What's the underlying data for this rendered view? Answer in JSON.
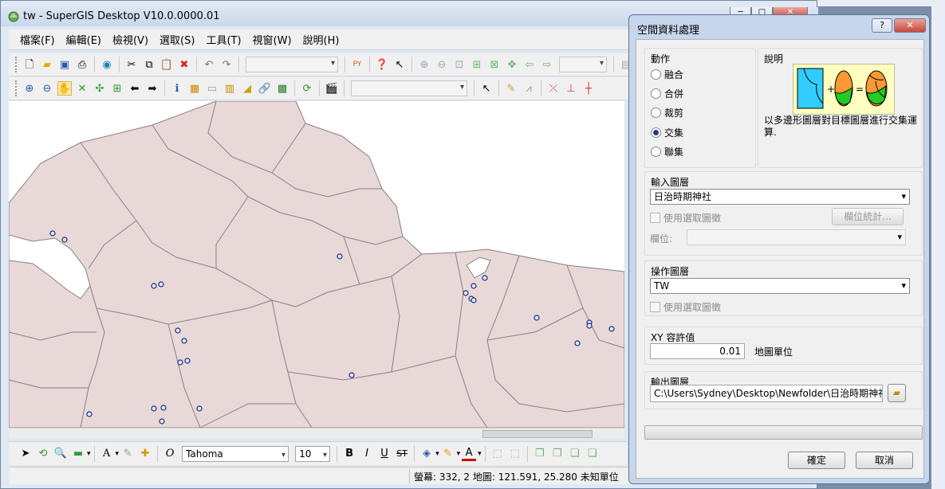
{
  "main_window": {
    "title": "tw - SuperGIS Desktop V10.0.0000.01",
    "menu": [
      "檔案(F)",
      "編輯(E)",
      "檢視(V)",
      "選取(S)",
      "工具(T)",
      "視窗(W)",
      "說明(H)"
    ]
  },
  "draw_toolbar": {
    "font_name": "Tahoma",
    "font_size": "10"
  },
  "status": {
    "text": "螢幕: 332, 2  地圖: 121.591, 25.280 未知單位"
  },
  "dialog": {
    "title": "空間資料處理",
    "action_group": {
      "label": "動作",
      "options": [
        "融合",
        "合併",
        "裁剪",
        "交集",
        "聯集"
      ],
      "selected": "交集"
    },
    "description": {
      "label": "說明",
      "text": "以多邊形圖層對目標圖層進行交集運算."
    },
    "input_layer": {
      "label": "輸入圖層",
      "value": "日治時期神社",
      "use_selection": "使用選取圖徵",
      "stats_button": "欄位統計...",
      "field_label": "欄位:"
    },
    "operation_layer": {
      "label": "操作圖層",
      "value": "TW",
      "use_selection": "使用選取圖徵"
    },
    "tolerance": {
      "label": "XY 容許值",
      "value": "0.01",
      "unit": "地圖單位"
    },
    "output_layer": {
      "label": "輸出圖層",
      "path": "C:\\Users\\Sydney\\Desktop\\Newfolder\\日治時期神社_Inters"
    },
    "ok_button": "確定",
    "cancel_button": "取消"
  },
  "colors": {
    "land": "#e8d8d8",
    "boundary": "#8a7f80",
    "point_fill": "#dfe9ff",
    "point_stroke": "#1c2a80"
  }
}
